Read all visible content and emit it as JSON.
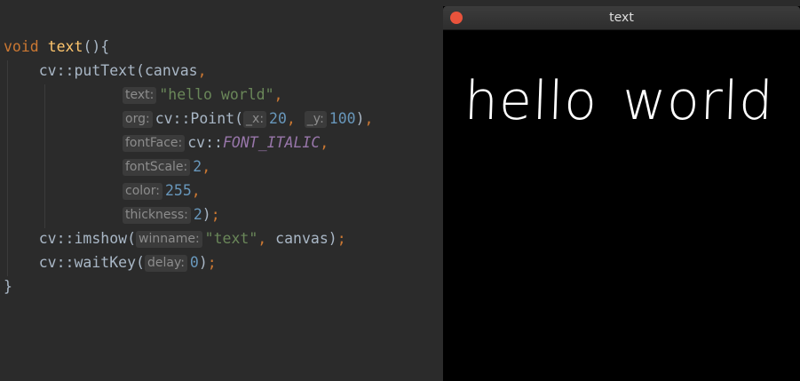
{
  "editor": {
    "l1": {
      "kw": "void",
      "fn": "text",
      "rest": "(){"
    },
    "l2": {
      "text": "cv::putText(canvas",
      "comma": ","
    },
    "l3": {
      "hint": "text:",
      "str": "\"hello world\"",
      "comma": ","
    },
    "l4": {
      "hint": "org:",
      "call": "cv::Point(",
      "hx": "_x:",
      "x": "20",
      "comma1": ",",
      "hy": "_y:",
      "y": "100",
      "close": ")",
      "comma2": ","
    },
    "l5": {
      "hint": "fontFace:",
      "ns": "cv::",
      "const": "FONT_ITALIC",
      "comma": ","
    },
    "l6": {
      "hint": "fontScale:",
      "num": "2",
      "comma": ","
    },
    "l7": {
      "hint": "color:",
      "num": "255",
      "comma": ","
    },
    "l8": {
      "hint": "thickness:",
      "num": "2",
      "close": ")",
      "semi": ";"
    },
    "l9": {
      "call": "cv::imshow(",
      "hint": "winname:",
      "str": "\"text\"",
      "comma": ",",
      "rest": " canvas)",
      "semi": ";"
    },
    "l10": {
      "call": "cv::waitKey(",
      "hint": "delay:",
      "num": "0",
      "close": ")",
      "semi": ";"
    },
    "l11": {
      "text": "}"
    }
  },
  "window": {
    "title": "text",
    "canvas_text": "hello world"
  }
}
